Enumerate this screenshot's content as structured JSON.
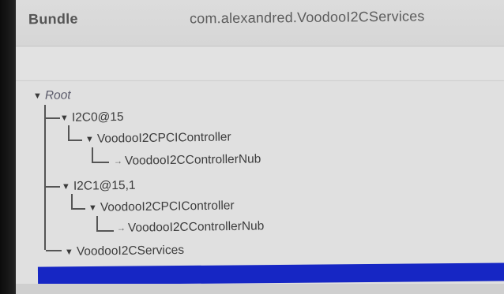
{
  "info_bar": {
    "key": "Bundle",
    "value": "com.alexandred.VoodooI2CServices"
  },
  "tree": {
    "root": "Root",
    "nodes": [
      {
        "label": "I2C0@15"
      },
      {
        "label": "VoodooI2CPCIController"
      },
      {
        "label": "VoodooI2CControllerNub"
      },
      {
        "label": "I2C1@15,1"
      },
      {
        "label": "VoodooI2CPCIController"
      },
      {
        "label": "VoodooI2CControllerNub"
      },
      {
        "label": "VoodooI2CServices"
      }
    ]
  },
  "icons": {
    "expanded": "disclosure-triangle-expanded-icon",
    "leaf": "tree-leaf-arrow-icon"
  },
  "colors": {
    "selection": "#1626c4",
    "background": "#e0e0e0",
    "text": "#3c3c3c"
  }
}
